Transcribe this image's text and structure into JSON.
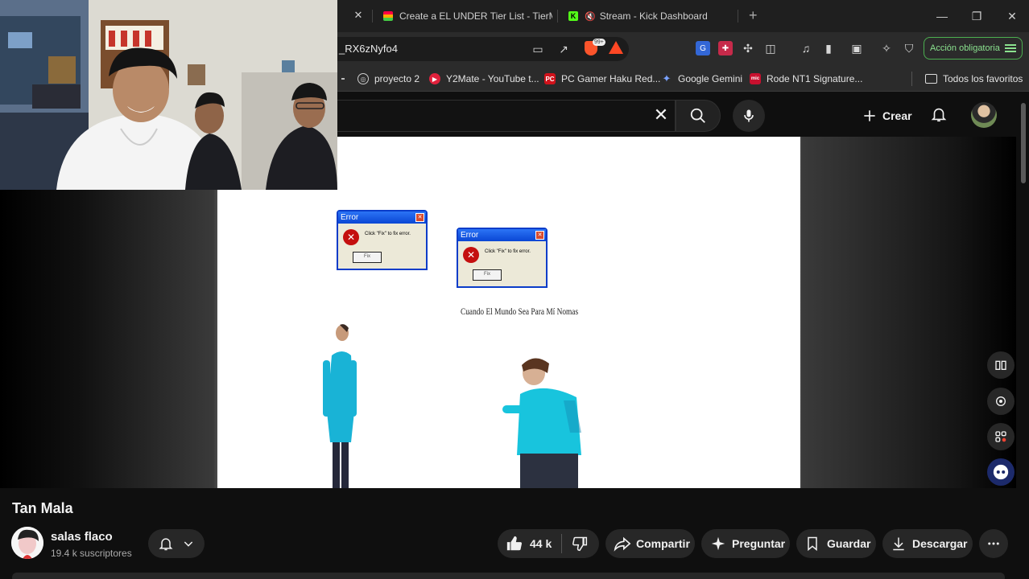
{
  "browser": {
    "tabs": [
      {
        "label": "Create a EL UNDER Tier List - TierMaker"
      },
      {
        "label": "Stream - Kick Dashboard"
      }
    ],
    "url_fragment": "_RX6zNyfo4",
    "brave_badge": "99+",
    "action_button": "Acción obligatoria",
    "bookmarks": [
      {
        "label": "proyecto 2"
      },
      {
        "label": "Y2Mate - YouTube t..."
      },
      {
        "label": "PC Gamer Haku Red..."
      },
      {
        "label": "Google Gemini"
      },
      {
        "label": "Rode NT1 Signature..."
      }
    ],
    "all_bookmarks": "Todos los favoritos",
    "colors": {
      "action_green": "#4caf50",
      "kick_green": "#53fc18",
      "brave_orange": "#fb542b"
    }
  },
  "youtube": {
    "create_label": "Crear",
    "icons": [
      "clear-icon",
      "search-icon",
      "mic-icon",
      "bell-icon"
    ]
  },
  "video_frame": {
    "error_title": "Error",
    "error_message": "Click \"Fix\" to fix error.",
    "fix_button": "Fix",
    "caption": "Cuando El Mundo Sea Para Mí Nomas"
  },
  "video": {
    "title": "Tan Mala",
    "channel": "salas flaco",
    "subscribers": "19.4 k suscriptores",
    "likes": "44 k",
    "share": "Compartir",
    "ask": "Preguntar",
    "save": "Guardar",
    "download": "Descargar"
  }
}
